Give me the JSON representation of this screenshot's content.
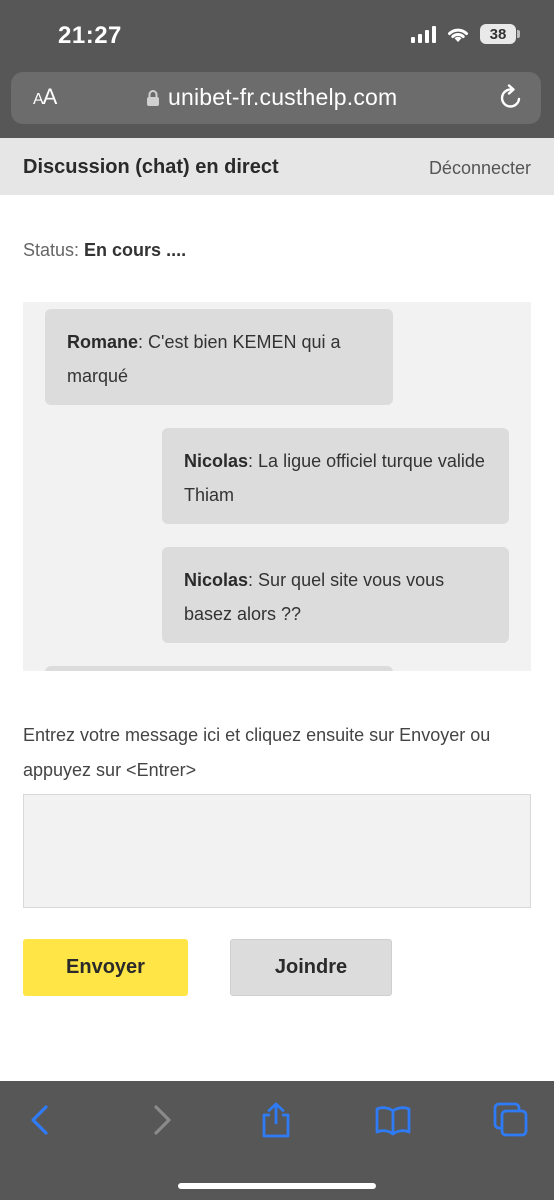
{
  "status_bar": {
    "time": "21:27",
    "battery": "38"
  },
  "browser": {
    "aa_label_small": "A",
    "aa_label_large": "A",
    "url": "unibet-fr.custhelp.com"
  },
  "header": {
    "title": "Discussion (chat) en direct",
    "disconnect": "Déconnecter"
  },
  "status": {
    "label": "Status:",
    "value": "En cours ...."
  },
  "messages": [
    {
      "author": "Romane",
      "text": "C'est bien KEMEN qui a marqué"
    },
    {
      "author": "Nicolas",
      "text": "La ligue officiel turque valide Thiam"
    },
    {
      "author": "Nicolas",
      "text": "Sur quel site vous vous basez alors ??"
    }
  ],
  "composer": {
    "instruction": "Entrez votre message ici et cliquez ensuite sur Envoyer ou appuyez sur <Entrer>",
    "value": "",
    "send_label": "Envoyer",
    "attach_label": "Joindre"
  },
  "toolbar_icons": [
    "back-icon",
    "forward-icon",
    "share-icon",
    "bookmarks-icon",
    "tabs-icon"
  ],
  "colors": {
    "chrome": "#575757",
    "accent_ios": "#2f7bf5",
    "send_button": "#ffe646"
  }
}
